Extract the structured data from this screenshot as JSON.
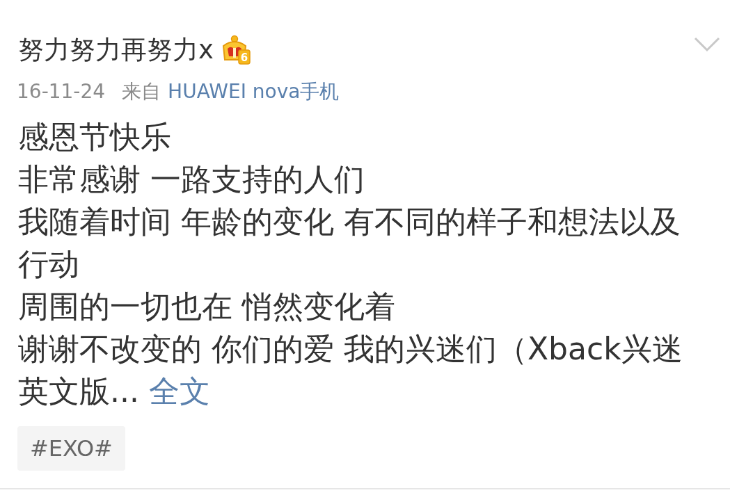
{
  "post": {
    "author": "努力努力再努力x",
    "vip_level": "6",
    "date": "16-11-24",
    "source_prefix": "来自",
    "source": "HUAWEI nova手机",
    "lines": [
      "感恩节快乐",
      "非常感谢 一路支持的人们",
      "我随着时间 年龄的变化 有不同的样子和想法以及行动",
      "周围的一切也在 悄然变化着",
      "谢谢不改变的 你们的爱 我的兴迷们（Xback兴迷英文版..."
    ],
    "more_link": "全文",
    "tags": [
      "#EXO#"
    ]
  }
}
